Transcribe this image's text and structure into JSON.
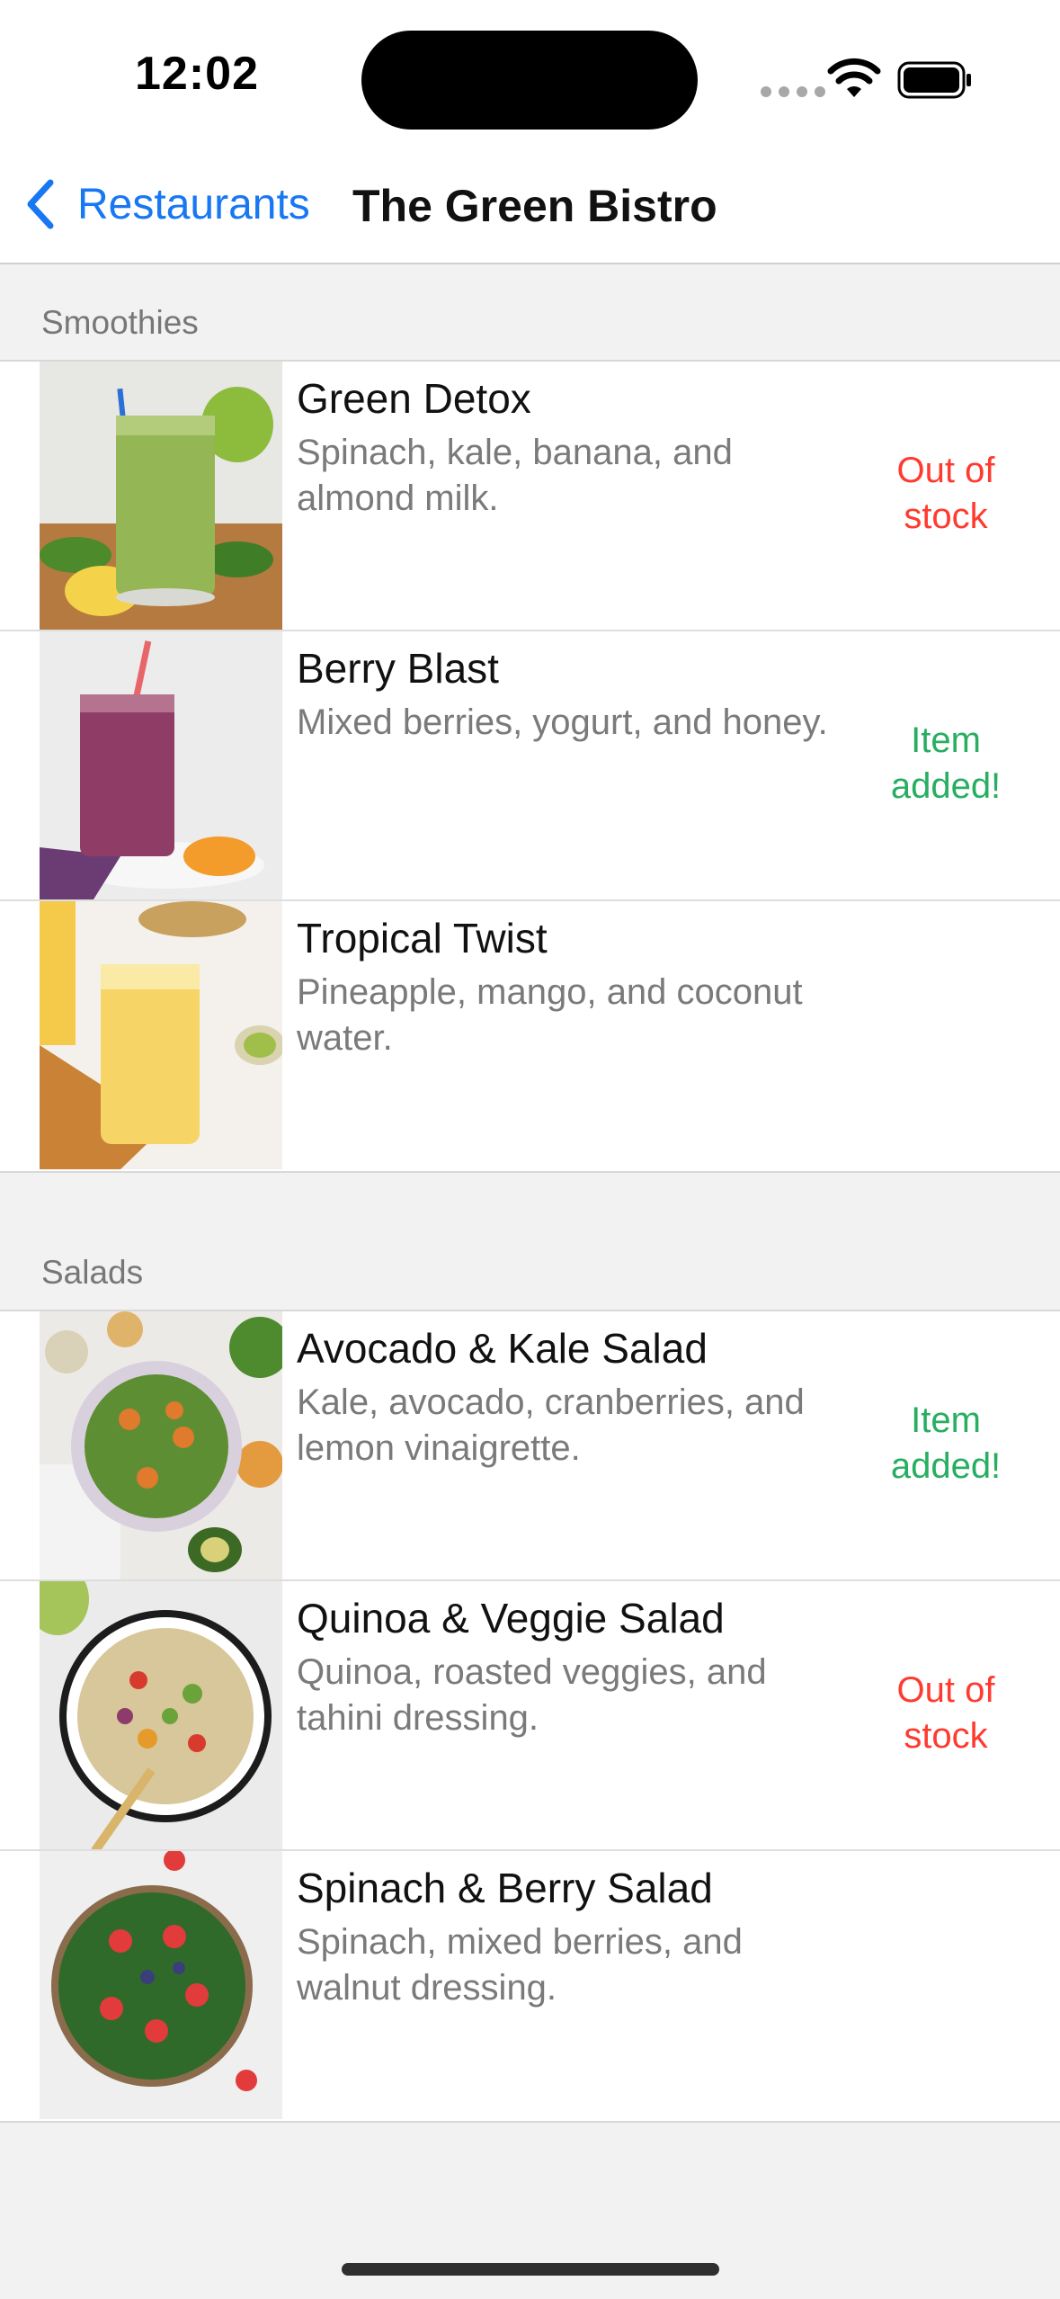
{
  "status_bar": {
    "time": "12:02"
  },
  "nav": {
    "back_label": "Restaurants",
    "title": "The Green Bistro"
  },
  "colors": {
    "accent": "#1877f2",
    "out_of_stock": "#ff3b30",
    "item_added": "#27ae60"
  },
  "sections": [
    {
      "title": "Smoothies",
      "items": [
        {
          "name": "Green Detox",
          "description": "Spinach, kale, banana, and almond milk.",
          "status": "Out of stock",
          "status_kind": "out",
          "image": "green-smoothie-image"
        },
        {
          "name": "Berry Blast",
          "description": "Mixed berries, yogurt, and honey.",
          "status": "Item added!",
          "status_kind": "added",
          "image": "berry-smoothie-image"
        },
        {
          "name": "Tropical Twist",
          "description": "Pineapple, mango, and coconut water.",
          "status": "",
          "status_kind": "none",
          "image": "tropical-smoothie-image"
        }
      ]
    },
    {
      "title": "Salads",
      "items": [
        {
          "name": "Avocado & Kale Salad",
          "description": "Kale, avocado, cranberries, and lemon vinaigrette.",
          "status": "Item added!",
          "status_kind": "added",
          "image": "kale-salad-image"
        },
        {
          "name": "Quinoa & Veggie Salad",
          "description": "Quinoa, roasted veggies, and tahini dressing.",
          "status": "Out of stock",
          "status_kind": "out",
          "image": "quinoa-salad-image"
        },
        {
          "name": "Spinach & Berry Salad",
          "description": "Spinach, mixed berries, and walnut dressing.",
          "status": "",
          "status_kind": "none",
          "image": "spinach-salad-image"
        }
      ]
    }
  ]
}
